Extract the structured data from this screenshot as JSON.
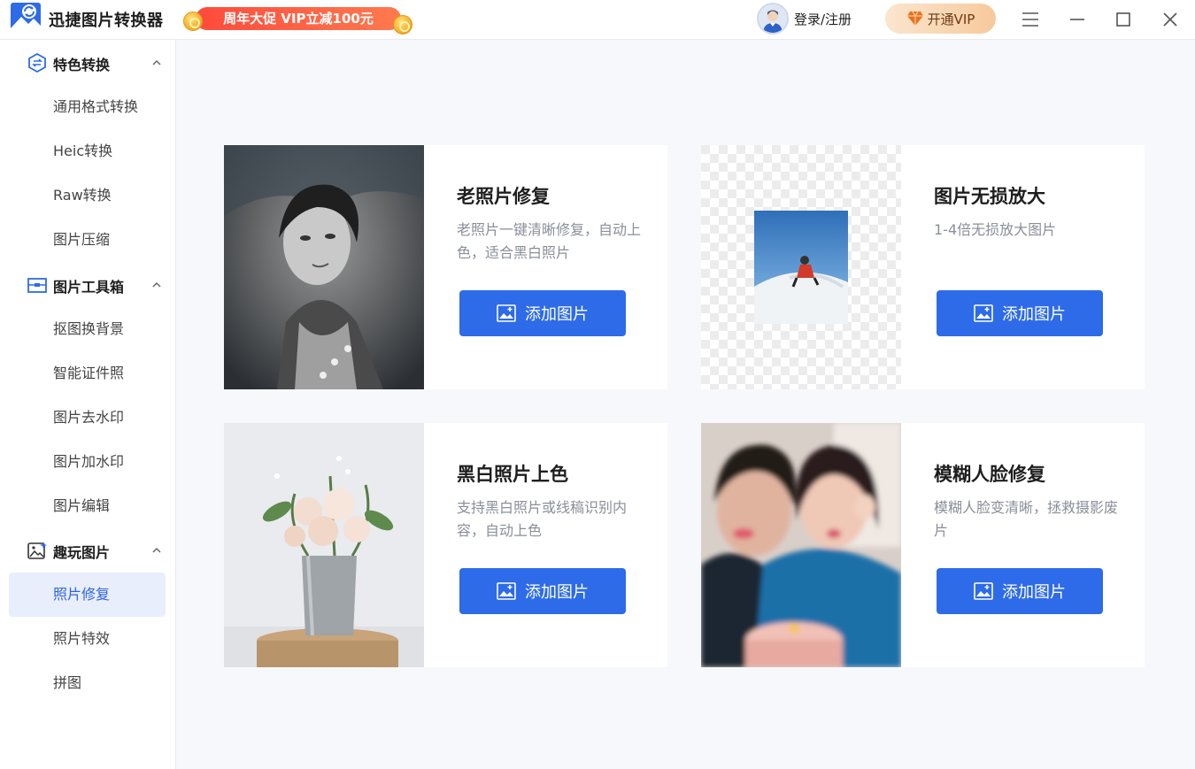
{
  "app": {
    "title": "迅捷图片转换器",
    "promo": "周年大促 VIP立减100元",
    "login": "登录/注册",
    "vip": "开通VIP"
  },
  "sidebar": {
    "groups": [
      {
        "label": "特色转换",
        "items": [
          "通用格式转换",
          "Heic转换",
          "Raw转换",
          "图片压缩"
        ]
      },
      {
        "label": "图片工具箱",
        "items": [
          "抠图换背景",
          "智能证件照",
          "图片去水印",
          "图片加水印",
          "图片编辑"
        ]
      },
      {
        "label": "趣玩图片",
        "items": [
          "照片修复",
          "照片特效",
          "拼图"
        ]
      }
    ],
    "active": "照片修复"
  },
  "cards": [
    {
      "title": "老照片修复",
      "desc": "老照片一键清晰修复，自动上色，适合黑白照片",
      "button": "添加图片"
    },
    {
      "title": "图片无损放大",
      "desc": "1-4倍无损放大图片",
      "button": "添加图片"
    },
    {
      "title": "黑白照片上色",
      "desc": "支持黑白照片或线稿识别内容，自动上色",
      "button": "添加图片"
    },
    {
      "title": "模糊人脸修复",
      "desc": "模糊人脸变清晰，拯救摄影废片",
      "button": "添加图片"
    }
  ],
  "colors": {
    "accent": "#2d6be8",
    "active_bg": "#e8eefc",
    "promo": "#ff4a3c",
    "vip_bg": "#f7c99c"
  }
}
